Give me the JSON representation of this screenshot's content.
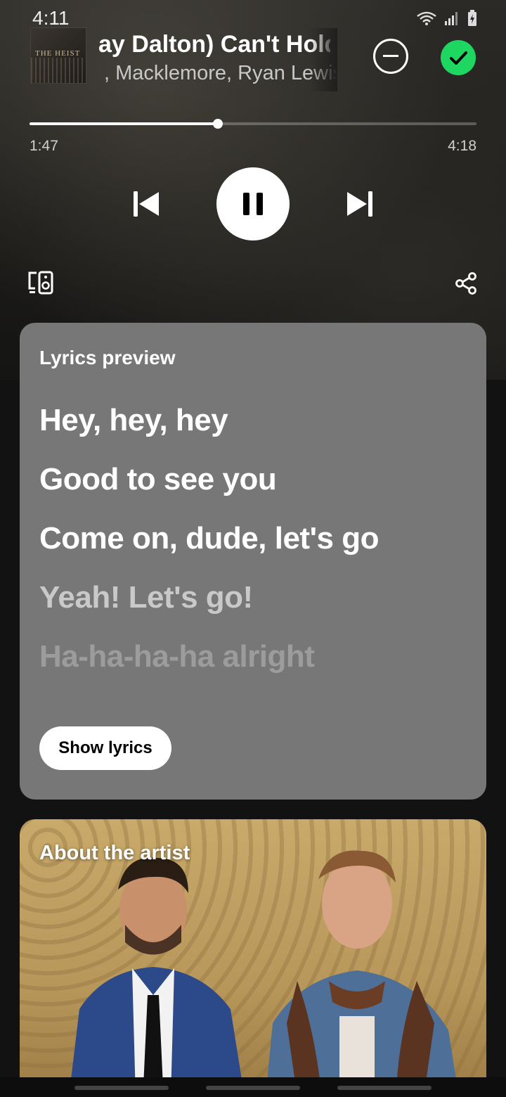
{
  "status_bar": {
    "time": "4:11",
    "icons": [
      "wifi-icon",
      "signal-icon",
      "battery-charging-icon"
    ]
  },
  "now_playing": {
    "title": "ay Dalton)          Can't Hold Us",
    "artist": ", Macklemore, Ryan Lewis",
    "album_art_text": "THE HEIST",
    "remove_icon": "minus-circle-icon",
    "added_icon": "check-circle-icon",
    "accent_color": "#1ed760"
  },
  "playback": {
    "elapsed": "1:47",
    "total": "4:18",
    "progress_fraction": 0.422,
    "prev_icon": "skip-previous-icon",
    "pause_icon": "pause-icon",
    "next_icon": "skip-next-icon",
    "devices_icon": "connect-devices-icon",
    "share_icon": "share-icon"
  },
  "lyrics_preview": {
    "heading": "Lyrics preview",
    "lines": [
      "Hey, hey, hey",
      "Good to see you",
      "Come on, dude, let's go",
      "Yeah! Let's go!",
      "Ha-ha-ha-ha alright"
    ],
    "button_label": "Show lyrics",
    "card_color": "#777777"
  },
  "about_artist": {
    "heading": "About the artist"
  }
}
